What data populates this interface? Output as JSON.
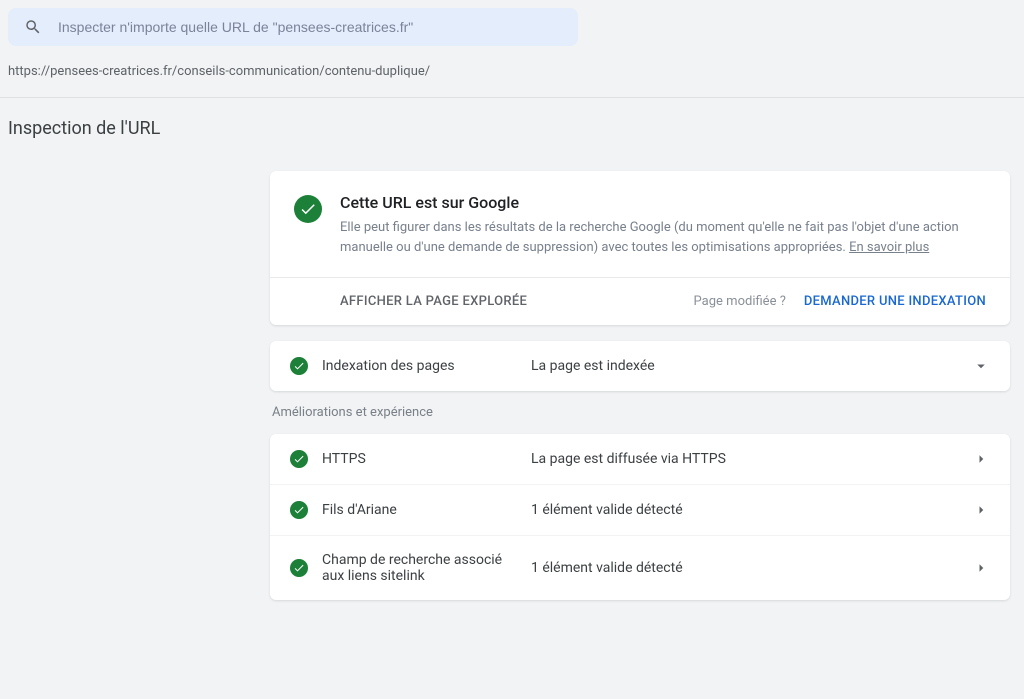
{
  "search": {
    "placeholder": "Inspecter n'importe quelle URL de \"pensees-creatrices.fr\""
  },
  "url": "https://pensees-creatrices.fr/conseils-communication/contenu-duplique/",
  "page_title": "Inspection de l'URL",
  "main_card": {
    "title": "Cette URL est sur Google",
    "description": "Elle peut figurer dans les résultats de la recherche Google (du moment qu'elle ne fait pas l'objet d'une action manuelle ou d'une demande de suppression) avec toutes les optimisations appropriées. ",
    "learn_more": "En savoir plus",
    "view_crawled": "AFFICHER LA PAGE EXPLORÉE",
    "page_modified": "Page modifiée ?",
    "request_indexing": "DEMANDER UNE INDEXATION"
  },
  "indexing_row": {
    "label": "Indexation des pages",
    "value": "La page est indexée"
  },
  "enhancements_heading": "Améliorations et expérience",
  "rows": [
    {
      "label": "HTTPS",
      "value": "La page est diffusée via HTTPS"
    },
    {
      "label": "Fils d'Ariane",
      "value": "1 élément valide détecté"
    },
    {
      "label": "Champ de recherche associé aux liens sitelink",
      "value": "1 élément valide détecté"
    }
  ]
}
